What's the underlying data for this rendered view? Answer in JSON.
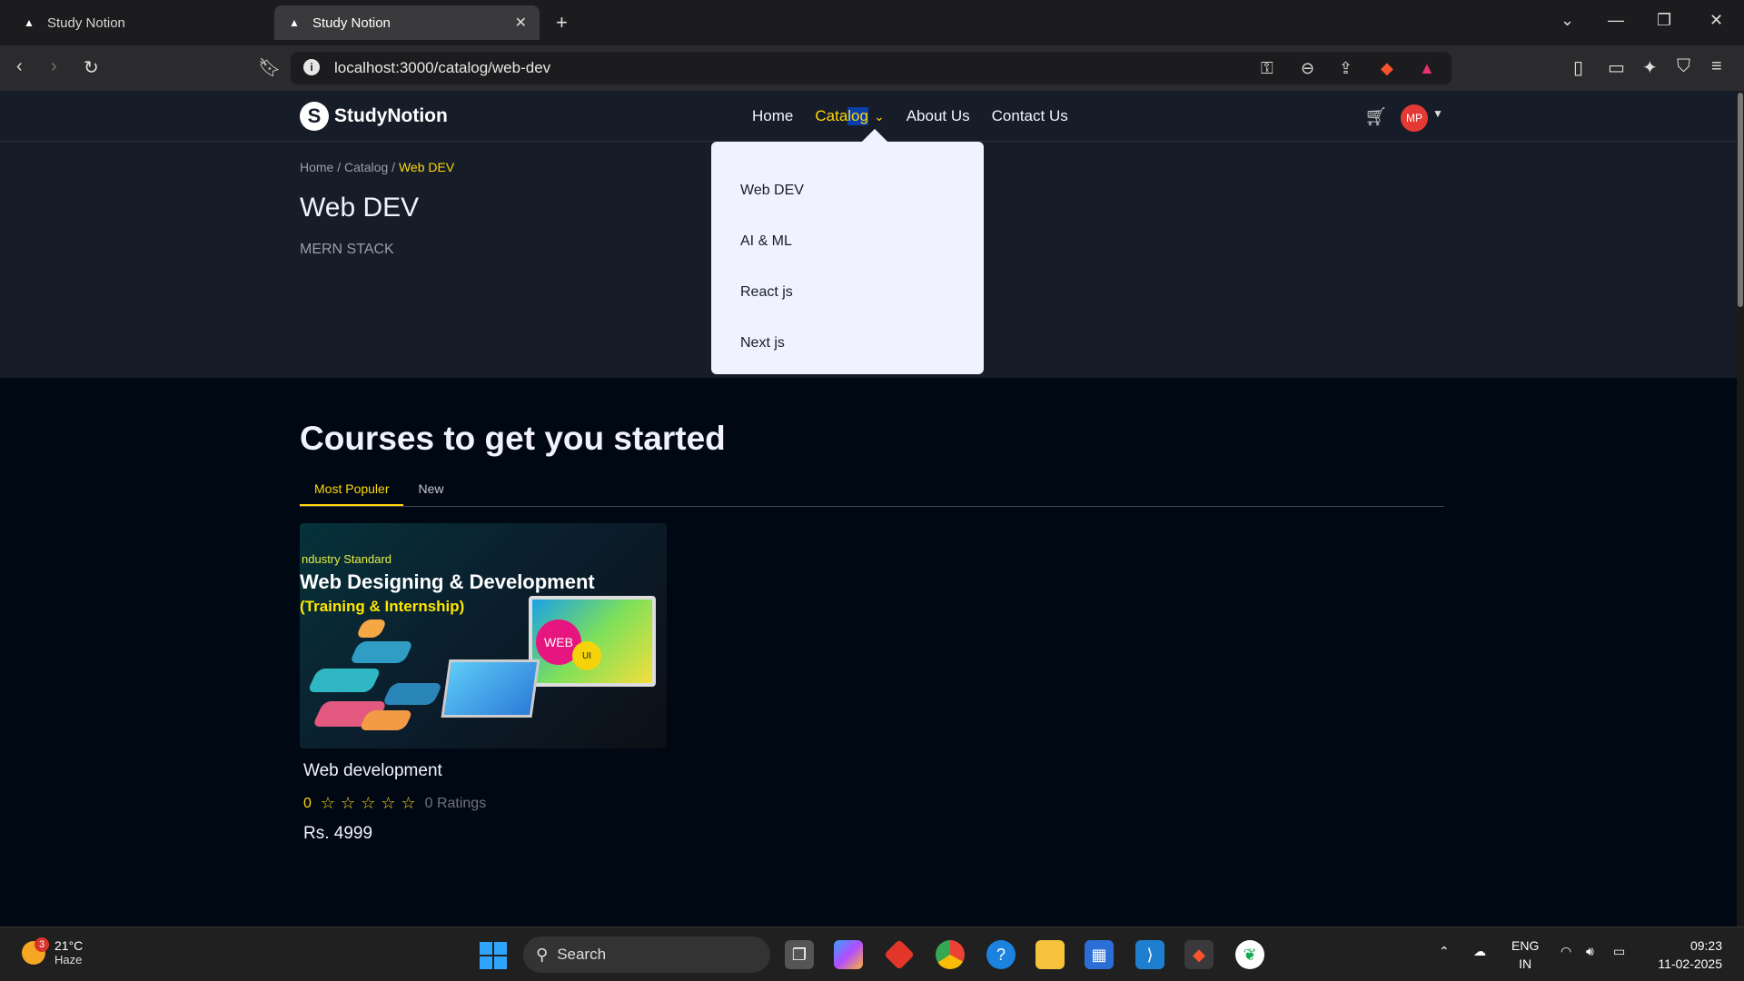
{
  "browser": {
    "tabs": [
      {
        "title": "Study Notion",
        "active": false
      },
      {
        "title": "Study Notion",
        "active": true
      }
    ],
    "url": "localhost:3000/catalog/web-dev"
  },
  "nav": {
    "brand": "StudyNotion",
    "brand_letter": "S",
    "links": [
      "Home",
      "Catalog",
      "About Us",
      "Contact Us"
    ],
    "catalog_sel": "log",
    "catalog_pre": "Cata",
    "avatar": "MP"
  },
  "dropdown": {
    "items": [
      "Web DEV",
      "AI & ML",
      "React js",
      "Next js"
    ]
  },
  "hero": {
    "crumb_home": "Home",
    "crumb_catalog": "Catalog",
    "crumb_current": "Web DEV",
    "title": "Web DEV",
    "description": "MERN STACK"
  },
  "section": {
    "title": "Courses to get you started",
    "tabs": [
      "Most Populer",
      "New"
    ]
  },
  "course": {
    "thumb_line1": "ndustry Standard",
    "thumb_line2": "Web Designing & Development",
    "thumb_line3": "(Training & Internship)",
    "thumb_badge1": "WEB",
    "thumb_badge2": "UI",
    "title": "Web development",
    "rating_value": "0",
    "stars": 5,
    "ratings_text": "0 Ratings",
    "price": "Rs. 4999"
  },
  "taskbar": {
    "temp": "21°C",
    "weather": "Haze",
    "weather_badge": "3",
    "search": "Search",
    "lang_top": "ENG",
    "lang_bottom": "IN",
    "time": "09:23",
    "date": "11-02-2025"
  },
  "colors": {
    "accent": "#ffd60a",
    "nav_bg": "#161d29",
    "page_bg": "#000814"
  }
}
